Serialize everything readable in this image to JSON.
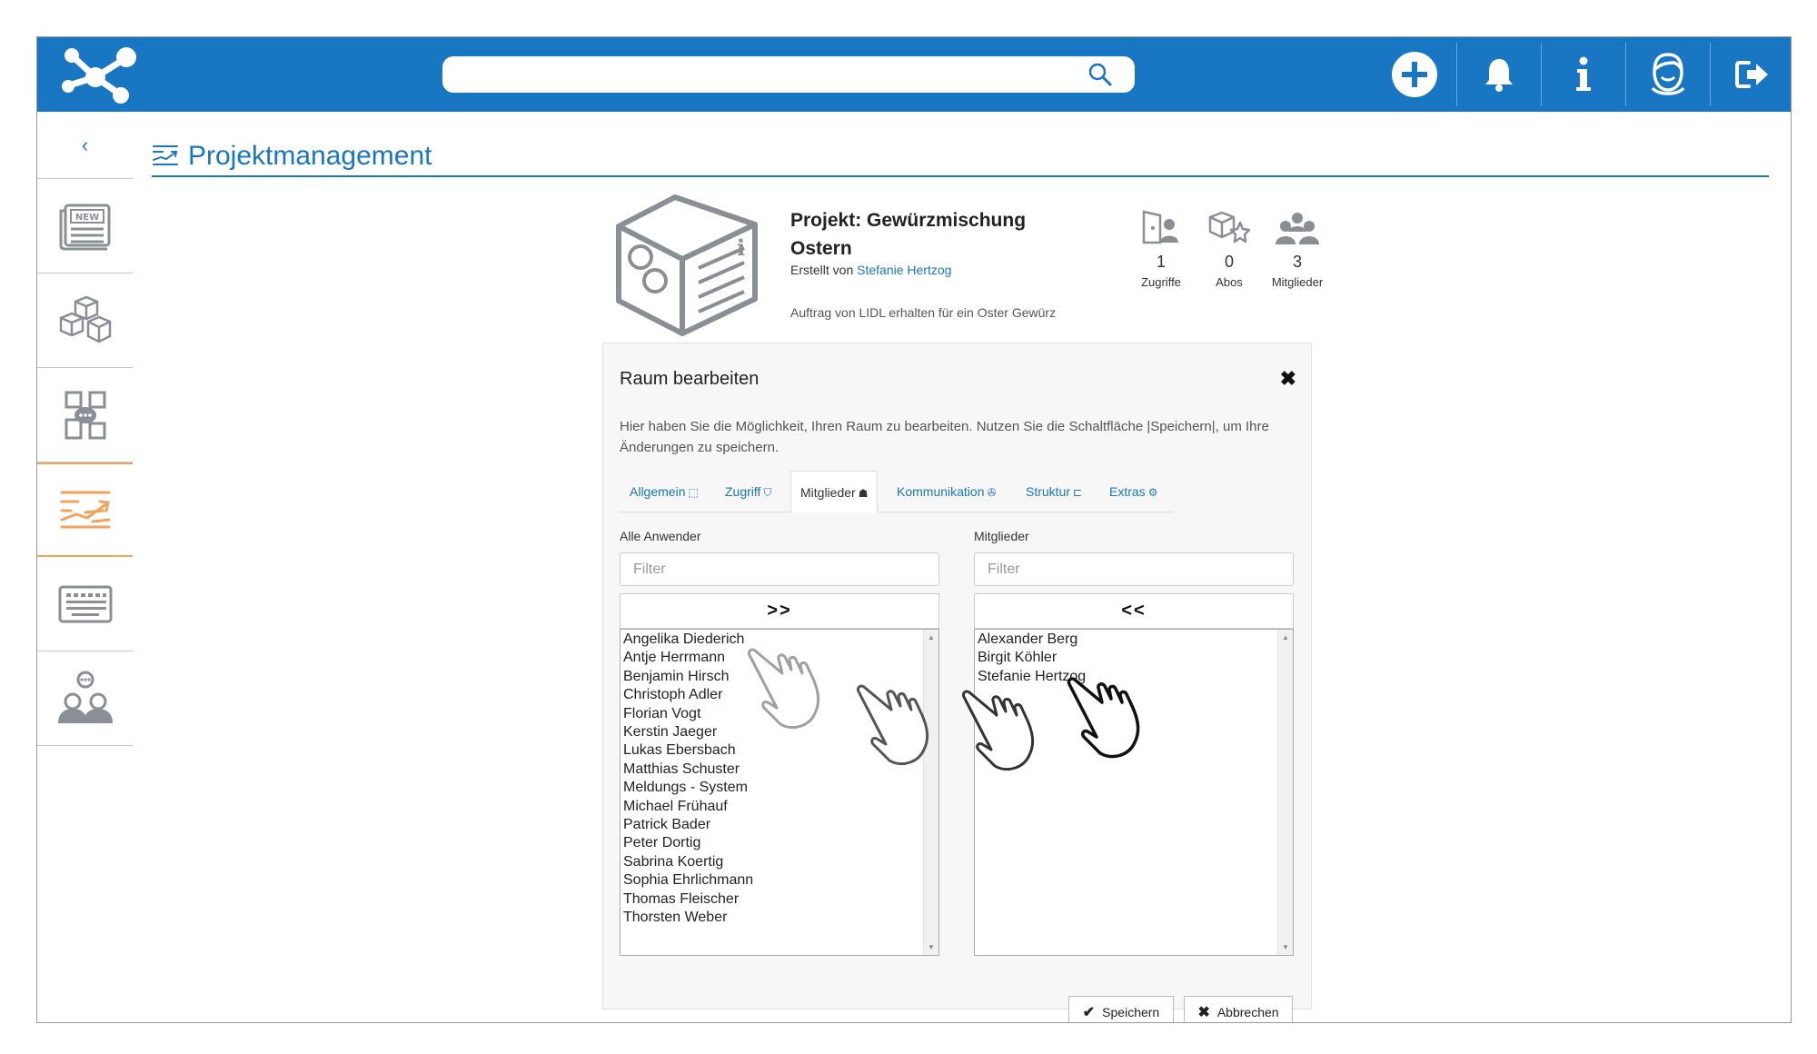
{
  "search": {
    "placeholder": "",
    "value": ""
  },
  "topbar": {
    "icons": [
      "add-icon",
      "bell-icon",
      "info-icon",
      "user-avatar-icon",
      "logout-icon"
    ]
  },
  "sidebar": {
    "back_label": "‹",
    "items": [
      "news-icon",
      "cubes-icon",
      "chat-rooms-icon",
      "project-management-icon",
      "keyboard-icon",
      "community-icon"
    ]
  },
  "page": {
    "title": "Projektmanagement"
  },
  "project": {
    "name": "Projekt: Gewürzmischung Ostern",
    "created_by_label": "Erstellt von",
    "creator": "Stefanie Hertzog",
    "description": "Auftrag von LIDL erhalten für ein Oster Gewürz",
    "stats": [
      {
        "value": "1",
        "label": "Zugriffe"
      },
      {
        "value": "0",
        "label": "Abos"
      },
      {
        "value": "3",
        "label": "Mitglieder"
      }
    ]
  },
  "modal": {
    "title": "Raum bearbeiten",
    "close": "✖",
    "description": "Hier haben Sie die Möglichkeit, Ihren Raum zu bearbeiten. Nutzen Sie die Schaltfläche |Speichern|, um Ihre Änderungen zu speichern.",
    "tabs": [
      {
        "label": "Allgemein",
        "icon": "⬚"
      },
      {
        "label": "Zugriff",
        "icon": "⛉"
      },
      {
        "label": "Mitglieder",
        "icon": "☗"
      },
      {
        "label": "Kommunikation",
        "icon": "✇"
      },
      {
        "label": "Struktur",
        "icon": "⊏"
      },
      {
        "label": "Extras",
        "icon": "⚙"
      }
    ],
    "left": {
      "label": "Alle Anwender",
      "filter_placeholder": "Filter",
      "move_label": ">>",
      "users": [
        "Angelika Diederich",
        "Antje Herrmann",
        "Benjamin Hirsch",
        "Christoph Adler",
        "Florian Vogt",
        "Kerstin Jaeger",
        "Lukas Ebersbach",
        "Matthias Schuster",
        "Meldungs - System",
        "Michael Frühauf",
        "Patrick Bader",
        "Peter Dortig",
        "Sabrina Koertig",
        "Sophia Ehrlichmann",
        "Thomas Fleischer",
        "Thorsten Weber"
      ]
    },
    "right": {
      "label": "Mitglieder",
      "filter_placeholder": "Filter",
      "move_label": "<<",
      "users": [
        "Alexander Berg",
        "Birgit Köhler",
        "Stefanie Hertzog"
      ]
    },
    "save_label": "Speichern",
    "cancel_label": "Abbrechen",
    "save_icon": "✔",
    "cancel_icon": "✖"
  },
  "colors": {
    "brand": "#1976c2",
    "active_accent": "#f2a25a"
  }
}
